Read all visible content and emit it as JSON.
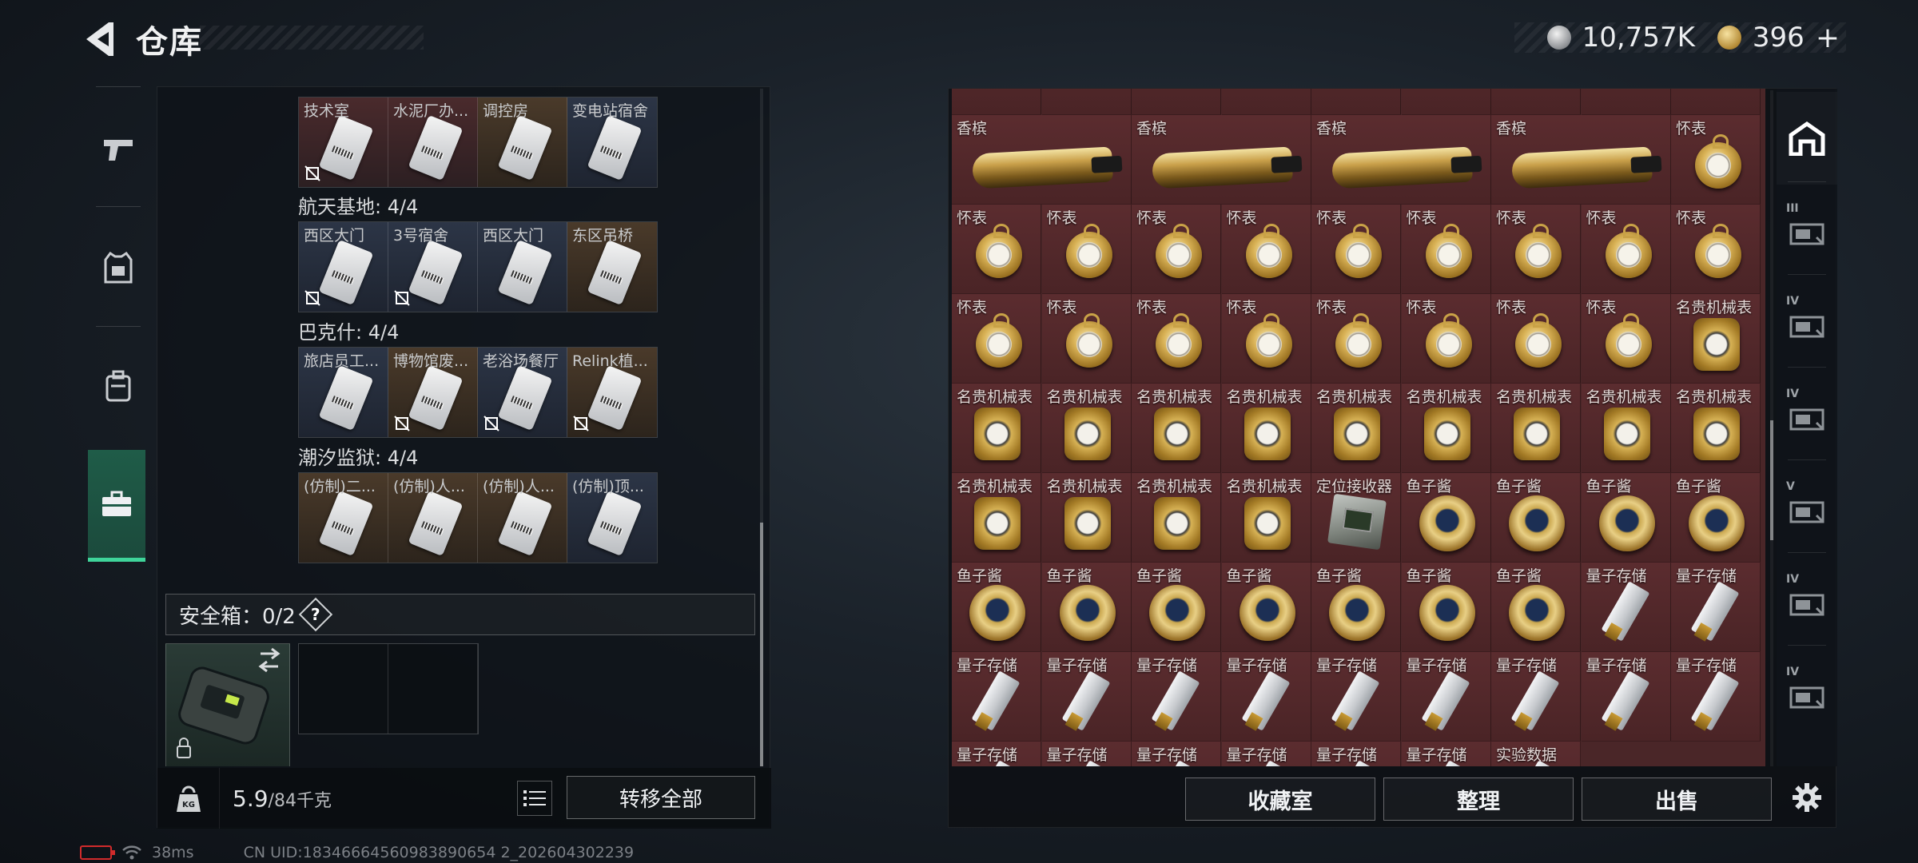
{
  "header": {
    "title": "仓库",
    "currency": [
      {
        "icon": "silver-coin-icon",
        "value": "10,757K"
      },
      {
        "icon": "gold-coin-icon",
        "value": "396"
      }
    ],
    "add_symbol": "+"
  },
  "left_tabs": [
    {
      "icon": "gun-icon",
      "active": false
    },
    {
      "icon": "armor-vest-icon",
      "active": false
    },
    {
      "icon": "backpack-icon",
      "active": false
    },
    {
      "icon": "briefcase-icon",
      "active": true
    }
  ],
  "key_sections": [
    {
      "title": "",
      "keys": [
        {
          "name": "技术室",
          "tint": "red",
          "no_trade": true
        },
        {
          "name": "水泥厂办...",
          "tint": "red",
          "no_trade": false
        },
        {
          "name": "调控房",
          "tint": "gold",
          "no_trade": false
        },
        {
          "name": "变电站宿舍",
          "tint": "blue",
          "no_trade": false
        }
      ]
    },
    {
      "title": "航天基地: 4/4",
      "keys": [
        {
          "name": "西区大门",
          "tint": "blue",
          "no_trade": true
        },
        {
          "name": "3号宿舍",
          "tint": "blue",
          "no_trade": true
        },
        {
          "name": "西区大门",
          "tint": "blue",
          "no_trade": false
        },
        {
          "name": "东区吊桥",
          "tint": "gold",
          "no_trade": false
        }
      ]
    },
    {
      "title": "巴克什: 4/4",
      "keys": [
        {
          "name": "旅店员工...",
          "tint": "blue",
          "no_trade": false
        },
        {
          "name": "博物馆废...",
          "tint": "gold",
          "no_trade": true
        },
        {
          "name": "老浴场餐厅",
          "tint": "blue",
          "no_trade": true
        },
        {
          "name": "Relink植...",
          "tint": "gold",
          "no_trade": true
        }
      ]
    },
    {
      "title": "潮汐监狱: 4/4",
      "keys": [
        {
          "name": "(仿制)二...",
          "tint": "gold",
          "no_trade": false
        },
        {
          "name": "(仿制)人...",
          "tint": "gold",
          "no_trade": false
        },
        {
          "name": "(仿制)人...",
          "tint": "gold",
          "no_trade": false
        },
        {
          "name": "(仿制)顶...",
          "tint": "blue",
          "no_trade": false
        }
      ]
    }
  ],
  "safe_box": {
    "label": "安全箱：0/2",
    "help": "?"
  },
  "left_footer": {
    "weight": "5.9",
    "capacity": "/84千克",
    "transfer_all": "转移全部"
  },
  "status": {
    "ping": "38ms",
    "uid": "CN UID:18346664560983890654 2_202604302239"
  },
  "storage_grid": {
    "rows": [
      [
        {
          "name": "香槟",
          "type": "bottle"
        },
        {
          "name": "香槟",
          "type": "bottle"
        },
        {
          "name": "香槟",
          "type": "bottle"
        },
        {
          "name": "香槟",
          "type": "bottle"
        },
        {
          "name": "怀表",
          "type": "pocketwatch"
        }
      ],
      [
        {
          "name": "怀表",
          "type": "pocketwatch"
        },
        {
          "name": "怀表",
          "type": "pocketwatch"
        },
        {
          "name": "怀表",
          "type": "pocketwatch"
        },
        {
          "name": "怀表",
          "type": "pocketwatch"
        },
        {
          "name": "怀表",
          "type": "pocketwatch"
        },
        {
          "name": "怀表",
          "type": "pocketwatch"
        },
        {
          "name": "怀表",
          "type": "pocketwatch"
        },
        {
          "name": "怀表",
          "type": "pocketwatch"
        },
        {
          "name": "怀表",
          "type": "pocketwatch"
        }
      ],
      [
        {
          "name": "怀表",
          "type": "pocketwatch"
        },
        {
          "name": "怀表",
          "type": "pocketwatch"
        },
        {
          "name": "怀表",
          "type": "pocketwatch"
        },
        {
          "name": "怀表",
          "type": "pocketwatch"
        },
        {
          "name": "怀表",
          "type": "pocketwatch"
        },
        {
          "name": "怀表",
          "type": "pocketwatch"
        },
        {
          "name": "怀表",
          "type": "pocketwatch"
        },
        {
          "name": "怀表",
          "type": "pocketwatch"
        },
        {
          "name": "名贵机械表",
          "type": "wristwatch"
        }
      ],
      [
        {
          "name": "名贵机械表",
          "type": "wristwatch"
        },
        {
          "name": "名贵机械表",
          "type": "wristwatch"
        },
        {
          "name": "名贵机械表",
          "type": "wristwatch"
        },
        {
          "name": "名贵机械表",
          "type": "wristwatch"
        },
        {
          "name": "名贵机械表",
          "type": "wristwatch"
        },
        {
          "name": "名贵机械表",
          "type": "wristwatch"
        },
        {
          "name": "名贵机械表",
          "type": "wristwatch"
        },
        {
          "name": "名贵机械表",
          "type": "wristwatch"
        },
        {
          "name": "名贵机械表",
          "type": "wristwatch"
        }
      ],
      [
        {
          "name": "名贵机械表",
          "type": "wristwatch"
        },
        {
          "name": "名贵机械表",
          "type": "wristwatch"
        },
        {
          "name": "名贵机械表",
          "type": "wristwatch"
        },
        {
          "name": "名贵机械表",
          "type": "wristwatch"
        },
        {
          "name": "定位接收器",
          "type": "receiver"
        },
        {
          "name": "鱼子酱",
          "type": "caviar"
        },
        {
          "name": "鱼子酱",
          "type": "caviar"
        },
        {
          "name": "鱼子酱",
          "type": "caviar"
        },
        {
          "name": "鱼子酱",
          "type": "caviar"
        }
      ],
      [
        {
          "name": "鱼子酱",
          "type": "caviar"
        },
        {
          "name": "鱼子酱",
          "type": "caviar"
        },
        {
          "name": "鱼子酱",
          "type": "caviar"
        },
        {
          "name": "鱼子酱",
          "type": "caviar"
        },
        {
          "name": "鱼子酱",
          "type": "caviar"
        },
        {
          "name": "鱼子酱",
          "type": "caviar"
        },
        {
          "name": "鱼子酱",
          "type": "caviar"
        },
        {
          "name": "量子存储",
          "type": "usb"
        },
        {
          "name": "量子存储",
          "type": "usb"
        }
      ],
      [
        {
          "name": "量子存储",
          "type": "usb"
        },
        {
          "name": "量子存储",
          "type": "usb"
        },
        {
          "name": "量子存储",
          "type": "usb"
        },
        {
          "name": "量子存储",
          "type": "usb"
        },
        {
          "name": "量子存储",
          "type": "usb"
        },
        {
          "name": "量子存储",
          "type": "usb"
        },
        {
          "name": "量子存储",
          "type": "usb"
        },
        {
          "name": "量子存储",
          "type": "usb"
        },
        {
          "name": "量子存储",
          "type": "usb"
        }
      ],
      [
        {
          "name": "量子存储",
          "type": "usb"
        },
        {
          "name": "量子存储",
          "type": "usb"
        },
        {
          "name": "量子存储",
          "type": "usb"
        },
        {
          "name": "量子存储",
          "type": "usb"
        },
        {
          "name": "量子存储",
          "type": "usb"
        },
        {
          "name": "量子存储",
          "type": "usb"
        },
        {
          "name": "实验数据",
          "type": "usb"
        }
      ]
    ]
  },
  "right_footer": {
    "collection": "收藏室",
    "organize": "整理",
    "sell": "出售"
  },
  "right_tabs": [
    {
      "icon": "home-storage-icon",
      "label": "",
      "active": true
    },
    {
      "icon": "storage-expansion-icon",
      "label": "III",
      "active": false
    },
    {
      "icon": "storage-expansion-icon",
      "label": "IV",
      "active": false
    },
    {
      "icon": "storage-expansion-icon",
      "label": "IV",
      "active": false
    },
    {
      "icon": "storage-expansion-icon",
      "label": "V",
      "active": false
    },
    {
      "icon": "storage-expansion-icon",
      "label": "IV",
      "active": false
    },
    {
      "icon": "storage-expansion-icon",
      "label": "IV",
      "active": false
    }
  ]
}
